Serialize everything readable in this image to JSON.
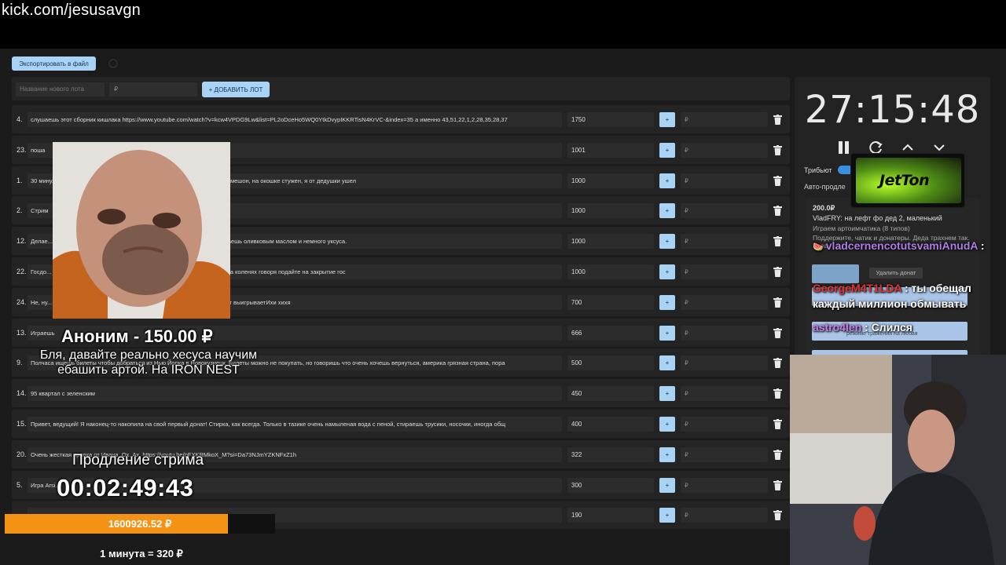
{
  "browser": {
    "url": "kick.com/jesusavgn"
  },
  "toolbar": {
    "export_label": "Экспортировать в файл",
    "lot_name_placeholder": "Название нового лота",
    "lot_price_placeholder": "₽",
    "add_lot_label": "+ ДОБАВИТЬ ЛОТ"
  },
  "lots": [
    {
      "num": "4.",
      "text": "слушаешь этот сборник кишлака https://www.youtube.com/watch?v=kcw4VPDG9Lw&list=PL2oDceHo5WQ0YtkDvypIKKRTisN4KrVC-&index=35 а именно 43,51,22,1,2,28,35,28,37",
      "amount": "1750"
    },
    {
      "num": "23.",
      "text": "поша",
      "amount": "1001"
    },
    {
      "num": "1.",
      "text": "30 мину... и говоришь: я по коробу скребен, по сусеку метен, на сметане мешон, на окошке стужен, я от дедушки ушел",
      "amount": "1000"
    },
    {
      "num": "2.",
      "text": "Стрим",
      "amount": "1000"
    },
    {
      "num": "12.",
      "text": "Делае... лат, режешь сыр, режешь оливки, режешь красный лук и поливаешь оливковым маслом и немного уксуса.",
      "amount": "1000"
    },
    {
      "num": "22.",
      "text": "Госдо... ум, следует из официальных данных. Так что 30 минут стоишь на коленях говоря подайте на закрытие гос",
      "amount": "1000"
    },
    {
      "num": "24.",
      "text": "Не, ну... , теперь пиво не за что братьЗакинь что третий репольнутый лот выигрываетИхи хихя",
      "amount": "700"
    },
    {
      "num": "13.",
      "text": "Играешь",
      "amount": "666"
    },
    {
      "num": "9.",
      "text": "Полчаса ищешь билеты чтобы добраться из Нью Йорка в Новокузнецк. Билеты можно не покупать, но говоришь что очень хочешь вернуться, америка грязная страна, пора",
      "amount": "500"
    },
    {
      "num": "14.",
      "text": "95 квартал с зеленским",
      "amount": "450"
    },
    {
      "num": "15.",
      "text": "Привет, ведущий! Я наконец-то накопила на свой первый донат! Стирка, как всегда. Только в тазике очень намыленая вода с пеной, стираешь трусики, носочки, иногда общ",
      "amount": "400"
    },
    {
      "num": "20.",
      "text": "Очень жесткая правка от Ивана. Ох. Ах. https://youtu.be/pFXKRMkoX_M?si=Da73NJmYZKNFxZ1h",
      "amount": "322"
    },
    {
      "num": "5.",
      "text": "Игра Arsi...",
      "amount": "300"
    },
    {
      "num": "",
      "text": "",
      "amount": "190"
    }
  ],
  "lot_controls": {
    "plus": "+",
    "currency": "₽"
  },
  "timer": {
    "value": "27:15:48",
    "tributes_label": "Трибьют",
    "auto_label": "Авто-продле"
  },
  "jetton": {
    "logo_text": "JetTon"
  },
  "donation_card": {
    "amount": "200.0₽",
    "author_line": "VladFRY: на лефт фо дед 2, маленький",
    "line2": "Играем артоимчатика (8 типов)",
    "line3": "Поддержите, чатик и донатеры. Деда трахнем так. Ураа",
    "delete_label": "Удалить донат",
    "box_text": "режиме тражения на любая"
  },
  "chat": [
    {
      "nick": "vladcernencotutsvamiAnudA",
      "nick_color": "#b07de8",
      "message": ":"
    },
    {
      "nick": "GeorgeM4T1LDA",
      "nick_color": "#e03232",
      "message": ": ты обещал каждый миллион обмывать"
    },
    {
      "nick": "astro4len",
      "nick_color": "#c77de6",
      "message": ": Слился"
    }
  ],
  "alert": {
    "title": "Аноним - 150.00 ₽",
    "message": "Бля, давайте реально хесуса научим ебашить артой. На IRON NEST"
  },
  "extension": {
    "label": "Продление стрима",
    "timer": "00:02:49:43"
  },
  "donations_bar": {
    "total": "1600926.52 ₽",
    "fill_fraction": 0.825
  },
  "rate": {
    "text": "1 минута = 320 ₽"
  },
  "colors": {
    "accent": "#a9d3f5",
    "bar": "#f39214",
    "background": "#1b1b1b"
  }
}
